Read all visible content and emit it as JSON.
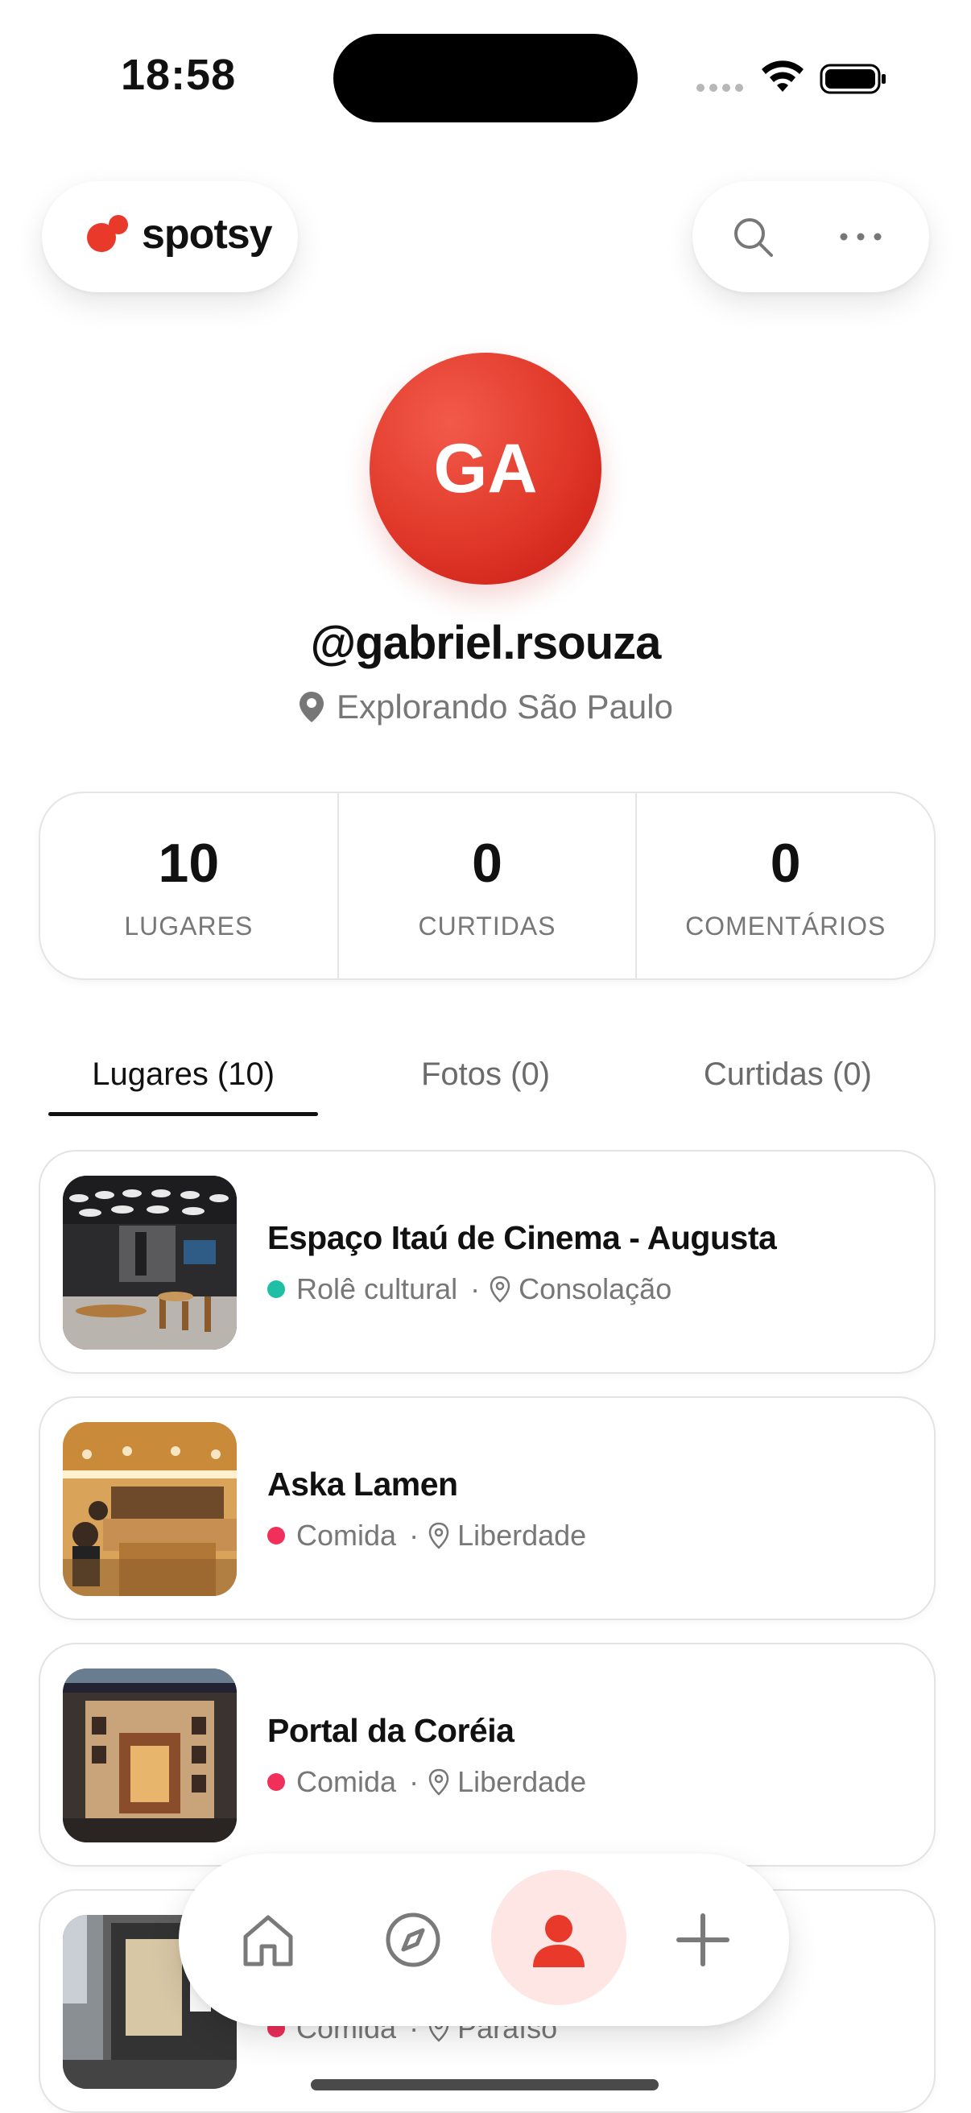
{
  "status_bar": {
    "time": "18:58"
  },
  "header": {
    "brand": "spotsy",
    "icons": [
      "search-icon",
      "more-icon"
    ]
  },
  "profile": {
    "initials": "GA",
    "username": "@gabriel.rsouza",
    "location": "Explorando São Paulo"
  },
  "stats": [
    {
      "value": "10",
      "label": "LUGARES"
    },
    {
      "value": "0",
      "label": "CURTIDAS"
    },
    {
      "value": "0",
      "label": "COMENTÁRIOS"
    }
  ],
  "tabs": [
    {
      "label": "Lugares (10)",
      "active": true
    },
    {
      "label": "Fotos (0)",
      "active": false
    },
    {
      "label": "Curtidas (0)",
      "active": false
    }
  ],
  "places": [
    {
      "name": "Espaço Itaú de Cinema - Augusta",
      "category": "Rolê cultural",
      "category_color": "#1fbfa6",
      "neighborhood": "Consolação"
    },
    {
      "name": "Aska Lamen",
      "category": "Comida",
      "category_color": "#f0305a",
      "neighborhood": "Liberdade"
    },
    {
      "name": "Portal da Coréia",
      "category": "Comida",
      "category_color": "#f0305a",
      "neighborhood": "Liberdade"
    },
    {
      "name": "",
      "category": "Comida",
      "category_color": "#f0305a",
      "neighborhood": "Paraíso"
    }
  ],
  "bottom_nav": {
    "items": [
      "home-icon",
      "explore-icon",
      "profile-icon",
      "add-icon"
    ],
    "active": "profile-icon",
    "accent": "#e8392b"
  }
}
